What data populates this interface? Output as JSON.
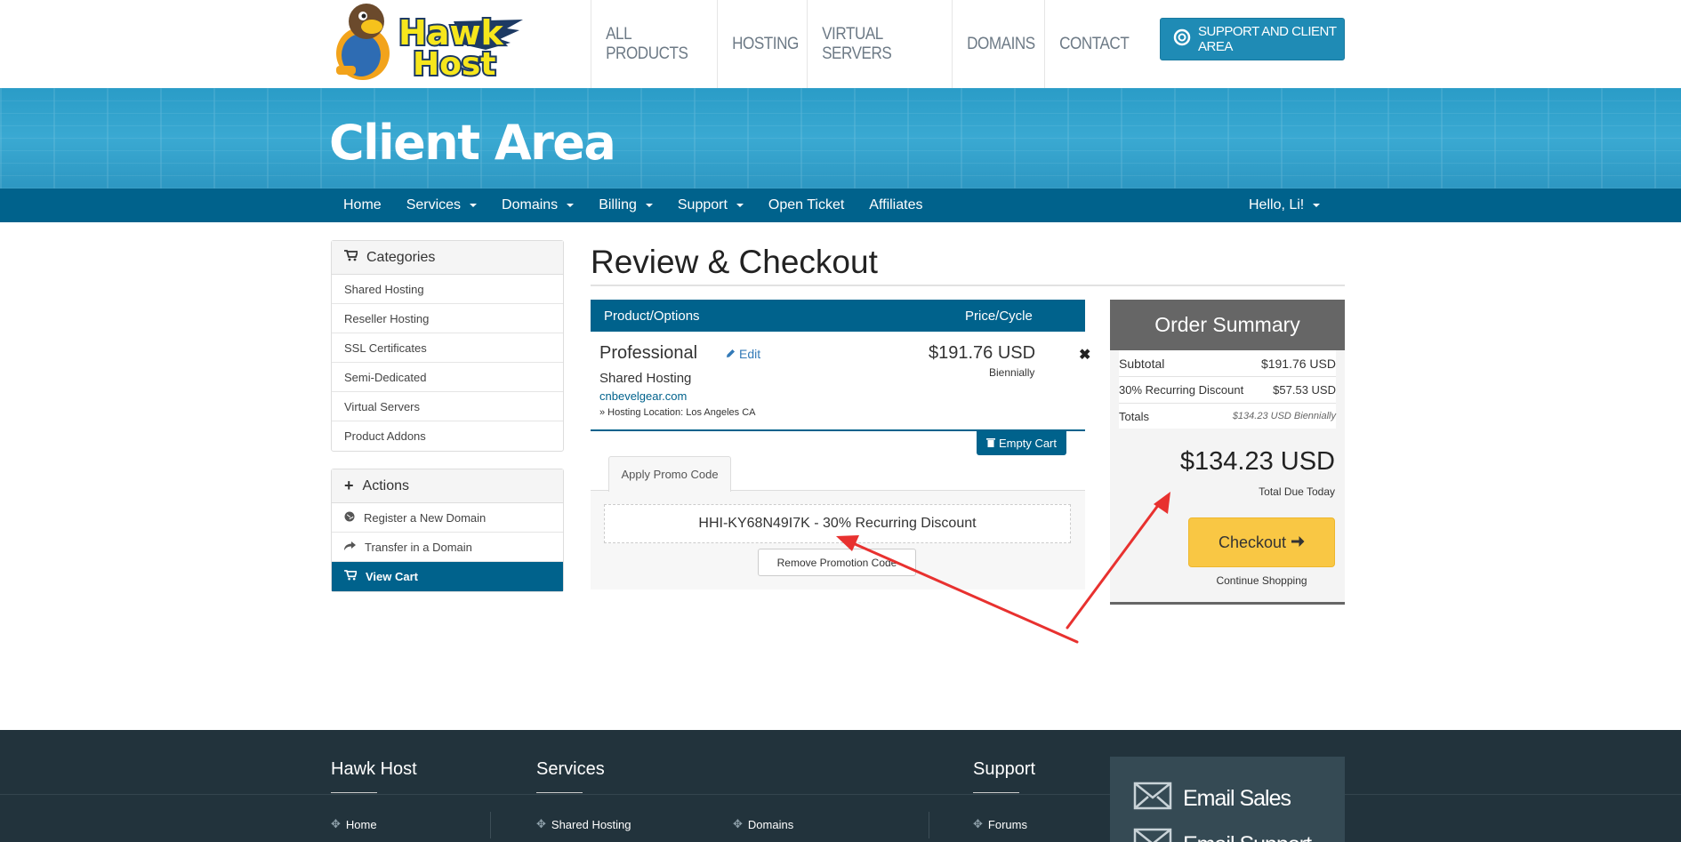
{
  "header": {
    "brand": "Hawk Host",
    "nav": [
      "ALL PRODUCTS",
      "HOSTING",
      "VIRTUAL SERVERS",
      "DOMAINS",
      "CONTACT"
    ],
    "support_button": "SUPPORT AND CLIENT AREA"
  },
  "banner": {
    "title": "Client Area"
  },
  "subnav": {
    "items": [
      "Home",
      "Services",
      "Domains",
      "Billing",
      "Support",
      "Open Ticket",
      "Affiliates"
    ],
    "user": "Hello, Li!"
  },
  "sidebar": {
    "categories_title": "Categories",
    "categories": [
      "Shared Hosting",
      "Reseller Hosting",
      "SSL Certificates",
      "Semi-Dedicated",
      "Virtual Servers",
      "Product Addons"
    ],
    "actions_title": "Actions",
    "actions": [
      "Register a New Domain",
      "Transfer in a Domain",
      "View Cart"
    ]
  },
  "main": {
    "title": "Review & Checkout",
    "col_product": "Product/Options",
    "col_price": "Price/Cycle",
    "item": {
      "name": "Professional",
      "edit": "Edit",
      "group": "Shared Hosting",
      "domain": "cnbevelgear.com",
      "location": "» Hosting Location: Los Angeles CA",
      "price": "$191.76 USD",
      "cycle": "Biennially",
      "remove": "✖"
    },
    "empty_cart": "Empty Cart",
    "promo_tab": "Apply Promo Code",
    "promo_code": "HHI-KY68N49I7K - 30% Recurring Discount",
    "remove_promo": "Remove Promotion Code"
  },
  "summary": {
    "title": "Order Summary",
    "subtotal_label": "Subtotal",
    "subtotal": "$191.76 USD",
    "discount_label": "30% Recurring Discount",
    "discount": "$57.53 USD",
    "totals_label": "Totals",
    "totals": "$134.23 USD Biennially",
    "total_due": "$134.23 USD",
    "total_due_label": "Total Due Today",
    "checkout": "Checkout",
    "continue": "Continue Shopping"
  },
  "footer": {
    "col1_title": "Hawk Host",
    "col2_title": "Services",
    "col3_title": "Support",
    "links": [
      "Home",
      "Shared Hosting",
      "Domains",
      "Forums"
    ],
    "email_sales": "Email Sales",
    "email_support": "Email Support"
  },
  "colors": {
    "primary": "#00628c",
    "banner": "#2a9cc7",
    "checkout": "#f9c744",
    "footer": "#22333c",
    "annotation_arrow": "#e8312f"
  }
}
